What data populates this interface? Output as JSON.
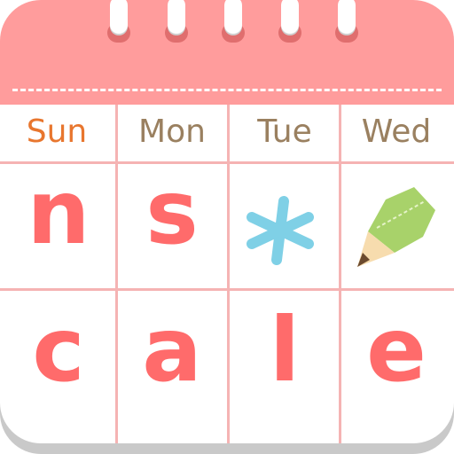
{
  "days": [
    "Sun",
    "Mon",
    "Tue",
    "Wed"
  ],
  "row1": [
    "n",
    "s"
  ],
  "row2": [
    "c",
    "a",
    "l",
    "e"
  ],
  "colors": {
    "header": "#ff9c9c",
    "letters": "#ff6b6b",
    "sunday": "#e8762e",
    "weekday": "#9a8060",
    "asterisk": "#7fd0e6",
    "pencil": "#a8d26a"
  },
  "icons": [
    "asterisk-icon",
    "pencil-icon"
  ]
}
